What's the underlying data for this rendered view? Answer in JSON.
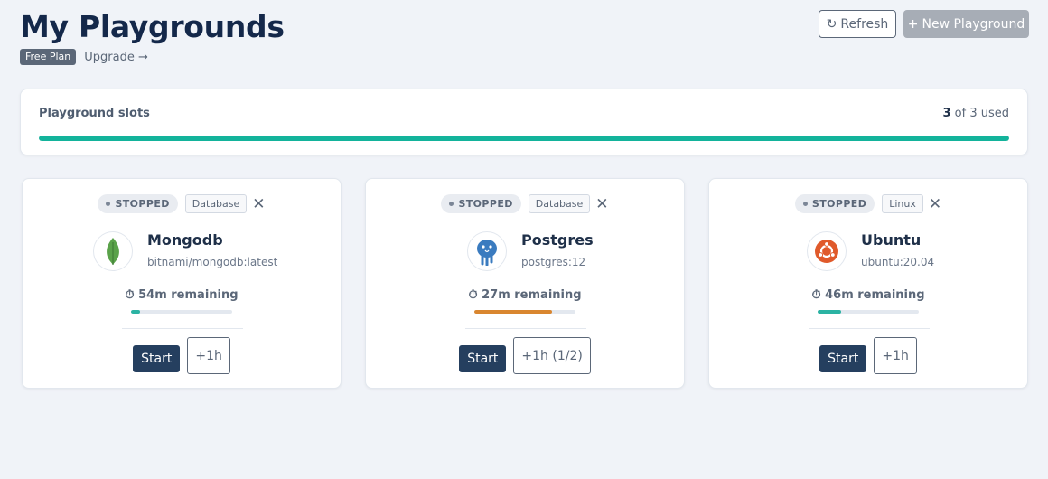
{
  "header": {
    "title": "My Playgrounds",
    "plan_badge": "Free Plan",
    "upgrade_link": "Upgrade →",
    "refresh_label": "Refresh",
    "refresh_icon": "↻",
    "new_label": "New Playground",
    "new_icon": "+"
  },
  "slots": {
    "label": "Playground slots",
    "used": "3",
    "of_text": "of 3 used",
    "fill_percent": 100
  },
  "cards": [
    {
      "status": "STOPPED",
      "category": "Database",
      "name": "Mongodb",
      "image": "bitnami/mongodb:latest",
      "logo_icon": "mongodb-leaf-icon",
      "remaining_icon": "⏱",
      "remaining": "54m remaining",
      "time_fill_percent": 9,
      "time_color": "#2bb3a3",
      "start_label": "Start",
      "extend_label": "+1h"
    },
    {
      "status": "STOPPED",
      "category": "Database",
      "name": "Postgres",
      "image": "postgres:12",
      "logo_icon": "postgres-elephant-icon",
      "remaining_icon": "⏱",
      "remaining": "27m remaining",
      "time_fill_percent": 77,
      "time_color": "#d9862f",
      "start_label": "Start",
      "extend_label": "+1h (1/2)"
    },
    {
      "status": "STOPPED",
      "category": "Linux",
      "name": "Ubuntu",
      "image": "ubuntu:20.04",
      "logo_icon": "ubuntu-logo-icon",
      "remaining_icon": "⏱",
      "remaining": "46m remaining",
      "time_fill_percent": 23,
      "time_color": "#2bb3a3",
      "start_label": "Start",
      "extend_label": "+1h"
    }
  ],
  "colors": {
    "background": "#f0f3f8",
    "title": "#14284a",
    "slots_fill": "#13b39b",
    "start_button": "#253f5f"
  }
}
